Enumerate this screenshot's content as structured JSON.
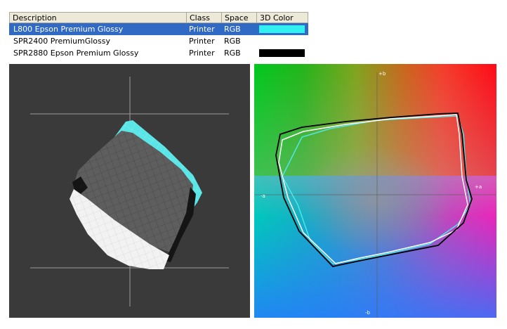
{
  "table": {
    "headers": [
      "Description",
      "Class",
      "Space",
      "3D Color"
    ],
    "rows": [
      {
        "description": "L800 Epson Premium Glossy",
        "class": "Printer",
        "space": "RGB",
        "color": "#33f0f0",
        "selected": true
      },
      {
        "description": "SPR2400 PremiumGlossy",
        "class": "Printer",
        "space": "RGB",
        "color": "",
        "selected": false
      },
      {
        "description": "SPR2880 Epson Premium Glossy",
        "class": "Printer",
        "space": "RGB",
        "color": "#000000",
        "selected": false
      }
    ]
  },
  "view2d": {
    "axis_labels": {
      "top": "+b",
      "bottom": "-b",
      "left": "-a",
      "right": "+a"
    },
    "curve_colors": [
      "#000000",
      "#ffffff",
      "#4fe6e6"
    ]
  },
  "view3d": {
    "background": "#3a3a3a",
    "solid_colors": [
      "#5ae6e6",
      "#5e5e5e",
      "#f2f2f2",
      "#151515"
    ]
  }
}
